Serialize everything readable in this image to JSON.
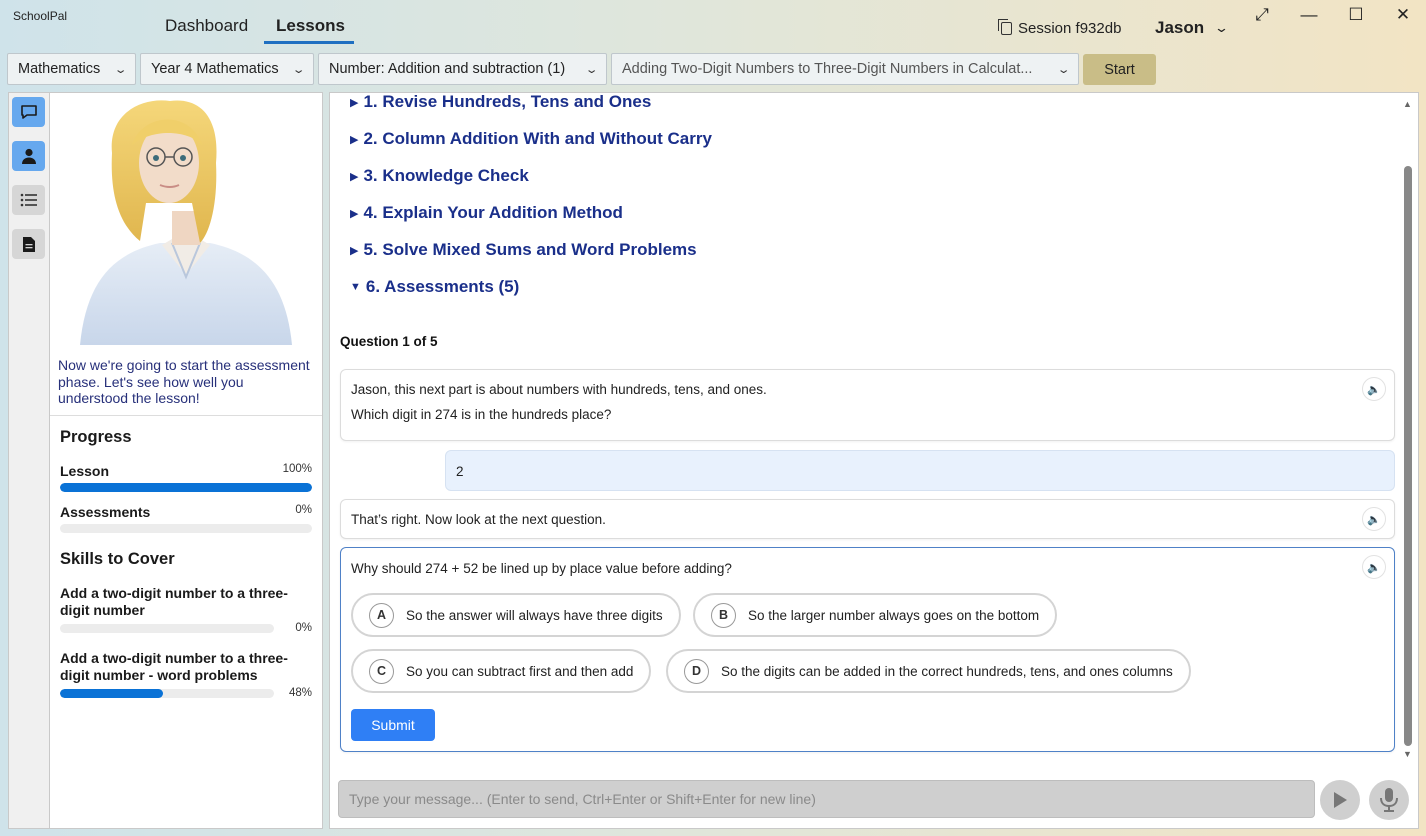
{
  "app": {
    "name": "SchoolPal"
  },
  "nav": {
    "tabs": [
      {
        "label": "Dashboard"
      },
      {
        "label": "Lessons"
      }
    ]
  },
  "session": {
    "label": "Session f932db"
  },
  "user": {
    "name": "Jason"
  },
  "selectors": {
    "subject": "Mathematics",
    "year": "Year 4 Mathematics",
    "unit": "Number: Addition and subtraction (1)",
    "topic": "Adding Two-Digit Numbers to Three-Digit Numbers in Calculat...",
    "start_label": "Start"
  },
  "tutor": {
    "message": "Now we're going to start the assessment phase. Let's see how well you understood the lesson!"
  },
  "progress": {
    "title": "Progress",
    "items": [
      {
        "label": "Lesson",
        "pct_text": "100%",
        "value": 100
      },
      {
        "label": "Assessments",
        "pct_text": "0%",
        "value": 0
      }
    ]
  },
  "skills": {
    "title": "Skills to Cover",
    "items": [
      {
        "label": "Add a two-digit number to a three-digit number",
        "pct_text": "0%",
        "value": 0
      },
      {
        "label": "Add a two-digit number to a three-digit number - word problems",
        "pct_text": "48%",
        "value": 48
      }
    ]
  },
  "lesson_sections": [
    {
      "label": "1. Revise Hundreds, Tens and Ones",
      "expanded": false
    },
    {
      "label": "2. Column Addition With and Without Carry",
      "expanded": false
    },
    {
      "label": "3. Knowledge Check",
      "expanded": false
    },
    {
      "label": "4. Explain Your Addition Method",
      "expanded": false
    },
    {
      "label": "5. Solve Mixed Sums and Word Problems",
      "expanded": false
    },
    {
      "label": "6. Assessments (5)",
      "expanded": true
    }
  ],
  "assessment": {
    "counter": "Question 1 of 5",
    "q1_line1": "Jason, this next part is about numbers with hundreds, tens, and ones.",
    "q1_line2": "Which digit in 274 is in the hundreds place?",
    "student_answer": "2",
    "feedback": "That’s right. Now look at the next question.",
    "q2": "Why should 274 + 52 be lined up by place value before adding?",
    "options": [
      {
        "letter": "A",
        "text": "So the answer will always have three digits"
      },
      {
        "letter": "B",
        "text": "So the larger number always goes on the bottom"
      },
      {
        "letter": "C",
        "text": "So you can subtract first and then add"
      },
      {
        "letter": "D",
        "text": "So the digits can be added in the correct hundreds, tens, and ones columns"
      }
    ],
    "submit_label": "Submit"
  },
  "composer": {
    "placeholder": "Type your message... (Enter to send, Ctrl+Enter or Shift+Enter for new line)"
  },
  "icons": {
    "chat": "chat-icon",
    "person": "person-icon",
    "list": "list-icon",
    "document": "document-icon",
    "speaker": "speaker-icon",
    "send": "send-icon",
    "mic": "mic-icon"
  },
  "colors": {
    "accent": "#0a72d6",
    "section_heading": "#1a2f8a",
    "start_button": "#c9bd87",
    "submit_button": "#2f7ff5"
  }
}
